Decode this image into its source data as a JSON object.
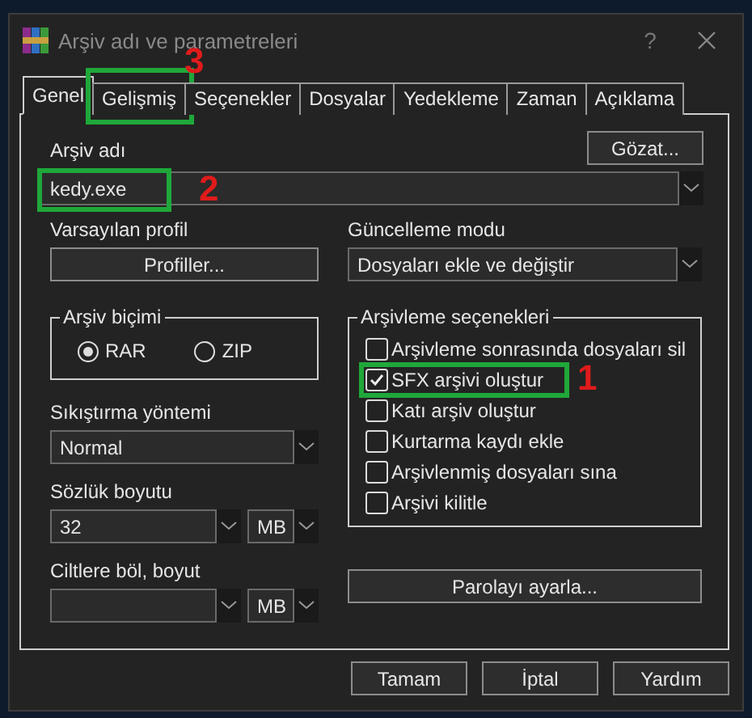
{
  "window": {
    "title": "Arşiv adı ve parametreleri",
    "help": "?"
  },
  "tabs": [
    {
      "label": "Genel",
      "selected": true
    },
    {
      "label": "Gelişmiş",
      "selected": false,
      "annotation": "3"
    },
    {
      "label": "Seçenekler",
      "selected": false
    },
    {
      "label": "Dosyalar",
      "selected": false
    },
    {
      "label": "Yedekleme",
      "selected": false
    },
    {
      "label": "Zaman",
      "selected": false
    },
    {
      "label": "Açıklama",
      "selected": false
    }
  ],
  "archive_name": {
    "label": "Arşiv adı",
    "value": "kedy.exe",
    "browse": "Gözat...",
    "annotation": "2"
  },
  "profile": {
    "label": "Varsayılan profil",
    "button": "Profiller..."
  },
  "update_mode": {
    "label": "Güncelleme modu",
    "value": "Dosyaları ekle ve değiştir"
  },
  "archive_format": {
    "label": "Arşiv biçimi",
    "options": [
      {
        "label": "RAR",
        "selected": true
      },
      {
        "label": "ZIP",
        "selected": false
      }
    ]
  },
  "compression": {
    "label": "Sıkıştırma yöntemi",
    "value": "Normal"
  },
  "dictionary": {
    "label": "Sözlük boyutu",
    "value": "32",
    "unit": "MB"
  },
  "split": {
    "label": "Ciltlere böl, boyut",
    "unit": "MB"
  },
  "archiving_options": {
    "label": "Arşivleme seçenekleri",
    "items": [
      {
        "label": "Arşivleme sonrasında dosyaları sil",
        "checked": false
      },
      {
        "label": "SFX arşivi oluştur",
        "checked": true,
        "annotation": "1"
      },
      {
        "label": "Katı arşiv oluştur",
        "checked": false
      },
      {
        "label": "Kurtarma kaydı ekle",
        "checked": false
      },
      {
        "label": "Arşivlenmiş dosyaları sına",
        "checked": false
      },
      {
        "label": "Arşivi kilitle",
        "checked": false
      }
    ]
  },
  "password_button": "Parolayı ayarla...",
  "buttons": [
    "Tamam",
    "İptal",
    "Yardım"
  ]
}
